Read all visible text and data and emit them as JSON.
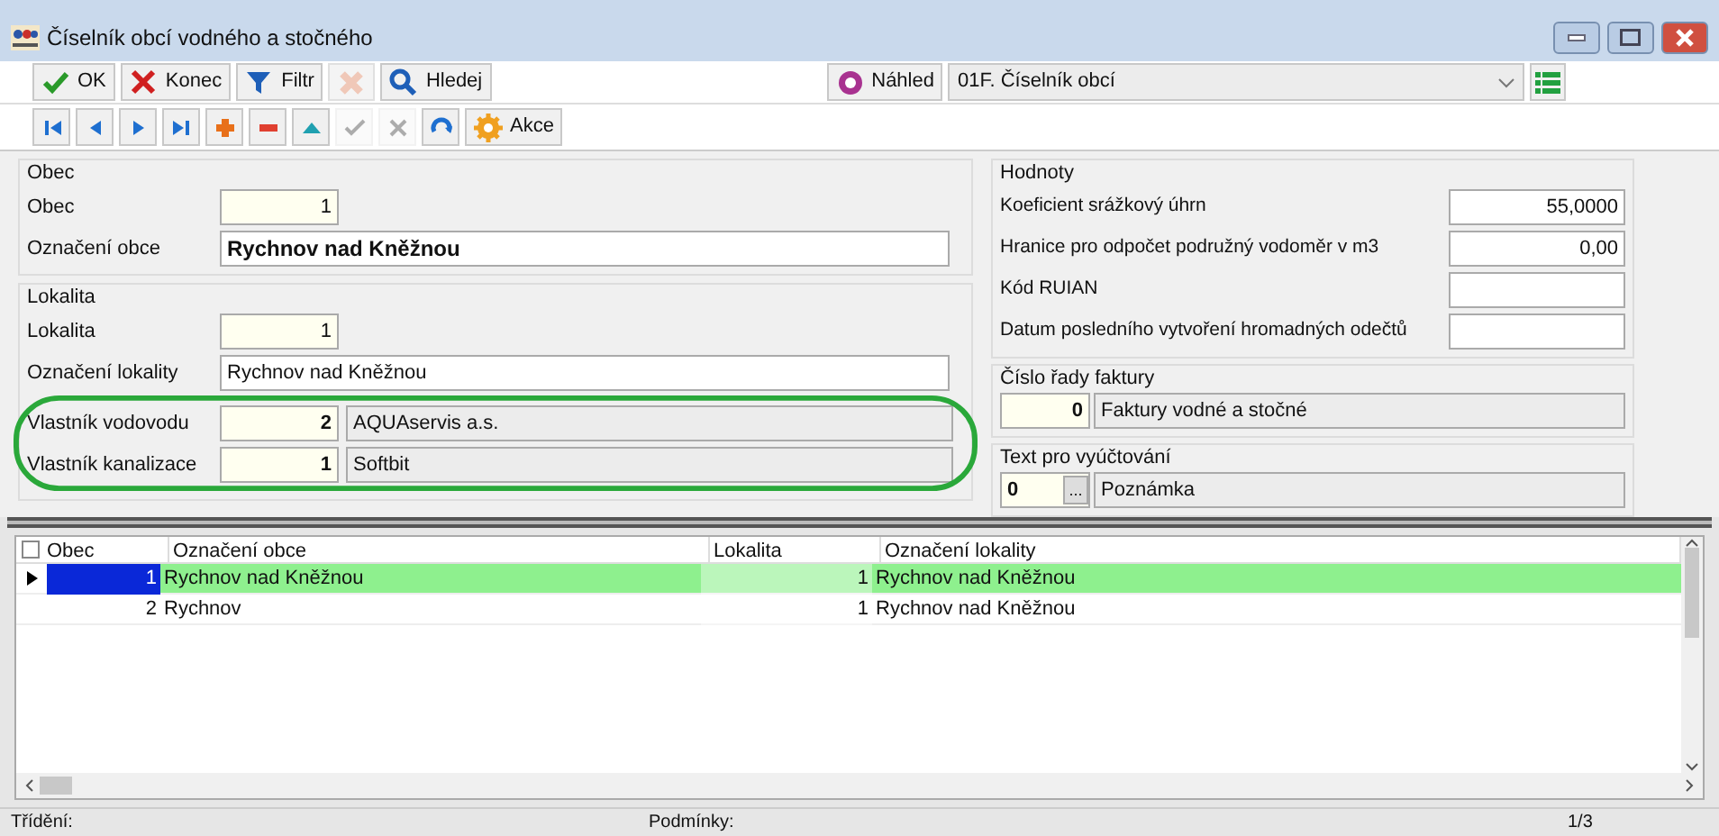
{
  "window": {
    "title": "Číselník obcí vodného a stočného"
  },
  "toolbar": {
    "buttons": [
      {
        "kind": "ok",
        "label": "OK",
        "disabled": false
      },
      {
        "kind": "close",
        "label": "Konec",
        "disabled": false
      },
      {
        "kind": "filter",
        "label": "Filtr",
        "disabled": false
      },
      {
        "kind": "clear",
        "disabled": true
      },
      {
        "kind": "search",
        "label": "Hledej",
        "disabled": false
      }
    ],
    "preview": {
      "label": "Náhled",
      "value": "01F. Číselník obcí"
    }
  },
  "nav": {
    "buttons": [
      {
        "kind": "first",
        "disabled": false
      },
      {
        "kind": "prev",
        "disabled": false
      },
      {
        "kind": "next",
        "disabled": false
      },
      {
        "kind": "last",
        "disabled": false
      },
      {
        "kind": "add",
        "disabled": false
      },
      {
        "kind": "delete",
        "disabled": false
      },
      {
        "kind": "up",
        "disabled": false
      },
      {
        "kind": "confirm",
        "disabled": true
      },
      {
        "kind": "cancel",
        "disabled": true
      },
      {
        "kind": "refresh",
        "disabled": false
      }
    ],
    "action": "Akce"
  },
  "obec": {
    "title": "Obec",
    "fields": [
      {
        "label": "Obec",
        "value": "1",
        "kind": "number"
      },
      {
        "label": "Označení obce",
        "value": "Rychnov nad Kněžnou",
        "kind": "text_bold"
      }
    ]
  },
  "lokalita": {
    "title": "Lokalita",
    "fields": [
      {
        "label": "Lokalita",
        "value": "1",
        "kind": "number"
      },
      {
        "label": "Označení lokality",
        "value": "Rychnov nad Kněžnou",
        "kind": "text"
      },
      {
        "label": "Vlastník vodovodu",
        "value": "2",
        "name": "AQUAservis a.s.",
        "kind": "lookup"
      },
      {
        "label": "Vlastník kanalizace",
        "value": "1",
        "name": "Softbit",
        "kind": "lookup"
      }
    ]
  },
  "hodnoty": {
    "title": "Hodnoty",
    "fields": [
      {
        "label": "Koeficient srážkový úhrn",
        "value": "55,0000"
      },
      {
        "label": "Hranice pro odpočet podružný vodoměr  v m3",
        "value": "0,00"
      },
      {
        "label": "Kód RUIAN"
      },
      {
        "label": "Datum posledního vytvoření hromadných odečtů"
      }
    ]
  },
  "invoice_series": {
    "title": "Číslo řady faktury",
    "value": "0",
    "name": "Faktury vodné a stočné"
  },
  "billing_text": {
    "title": "Text pro vyúčtování",
    "value": "0",
    "button": "...",
    "name": "Poznámka"
  },
  "table": {
    "select_all": {
      "checked": false
    },
    "columns": [
      "Obec",
      "Označení obce",
      "Lokalita",
      "Označení lokality"
    ],
    "rows": [
      {
        "cells": [
          "1",
          "Rychnov nad Kněžnou",
          "1",
          "Rychnov nad Kněžnou"
        ],
        "selected": true
      },
      {
        "cells": [
          "2",
          "Rychnov",
          "1",
          "Rychnov nad Kněžnou"
        ],
        "selected": false
      }
    ]
  },
  "status_bar": {
    "sort": "Třídění:",
    "conditions": "Podmínky:",
    "position": "1/3"
  }
}
